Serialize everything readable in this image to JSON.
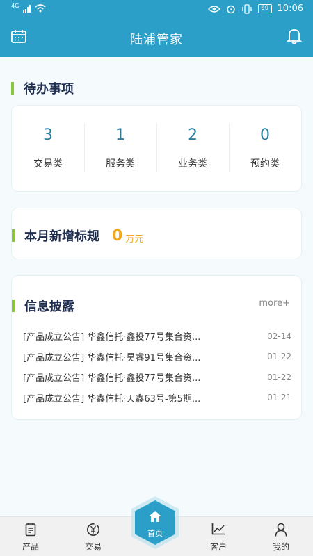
{
  "status_bar": {
    "network": "4G",
    "battery": "69",
    "time": "10:06"
  },
  "header": {
    "title": "陆浦管家"
  },
  "todo": {
    "title": "待办事项",
    "items": [
      {
        "count": "3",
        "label": "交易类"
      },
      {
        "count": "1",
        "label": "服务类"
      },
      {
        "count": "2",
        "label": "业务类"
      },
      {
        "count": "0",
        "label": "预约类"
      }
    ]
  },
  "new_scale": {
    "title": "本月新增标规",
    "amount": "0",
    "unit": "万元"
  },
  "disclosure": {
    "title": "信息披露",
    "more": "more+",
    "items": [
      {
        "text": "[产品成立公告] 华鑫信托·鑫投77号集合资...",
        "date": "02-14"
      },
      {
        "text": "[产品成立公告] 华鑫信托·昊睿91号集合资...",
        "date": "01-22"
      },
      {
        "text": "[产品成立公告] 华鑫信托·鑫投77号集合资...",
        "date": "01-22"
      },
      {
        "text": "[产品成立公告] 华鑫信托·天鑫63号-第5期...",
        "date": "01-21"
      }
    ]
  },
  "tabbar": {
    "products": "产品",
    "trade": "交易",
    "home": "首页",
    "clients": "客户",
    "mine": "我的"
  },
  "colors": {
    "primary": "#2b9fc8",
    "accent_bar": "#8cc63f",
    "amount": "#f2a81d"
  }
}
